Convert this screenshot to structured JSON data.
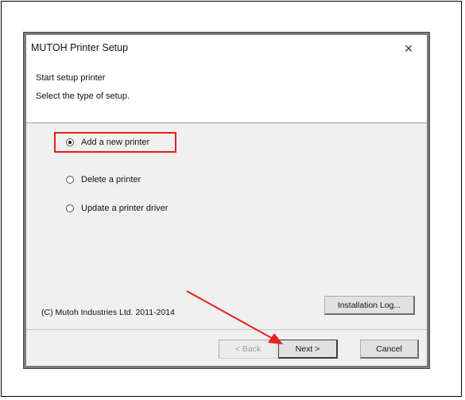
{
  "window": {
    "title": "MUTOH Printer Setup",
    "close_label": "×"
  },
  "header": {
    "line1": "Start setup printer",
    "line2": "Select the type of setup."
  },
  "options": [
    {
      "label": "Add a new printer",
      "checked": true
    },
    {
      "label": "Delete a printer",
      "checked": false
    },
    {
      "label": "Update a printer driver",
      "checked": false
    }
  ],
  "footer": {
    "copyright": "(C) Mutoh Industries Ltd. 2011-2014",
    "log_button": "Installation Log...",
    "back_button": "< Back",
    "next_button": "Next >",
    "cancel_button": "Cancel"
  },
  "colors": {
    "highlight": "#e2231a",
    "arrow": "#e2231a"
  }
}
